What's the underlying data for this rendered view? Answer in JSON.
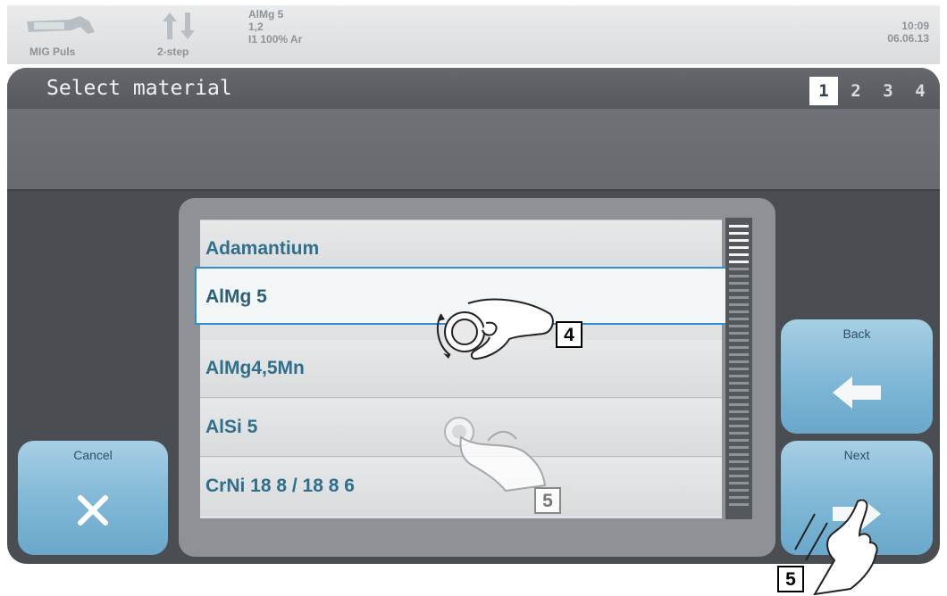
{
  "status": {
    "mode_label": "MIG Puls",
    "step_label": "2-step",
    "material_lines": [
      "AlMg 5",
      "1,2",
      "I1 100% Ar"
    ],
    "time": "10:09",
    "date": "06.06.13",
    "icons": [
      "mig-puls-torch-icon",
      "two-step-arrows-icon"
    ]
  },
  "header": {
    "title": "Select material",
    "pages": [
      "1",
      "2",
      "3",
      "4"
    ],
    "active_page": "1"
  },
  "materials": {
    "items": [
      "Adamantium",
      "AlMg 5",
      "AlMg4,5Mn",
      "AlSi 5",
      "CrNi 18 8 / 18 8 6"
    ],
    "selected": "AlMg 5"
  },
  "buttons": {
    "cancel": "Cancel",
    "back": "Back",
    "next": "Next",
    "icons": [
      "close-x-icon",
      "arrow-left-icon",
      "arrow-right-icon"
    ]
  },
  "callouts": {
    "dial": "4",
    "touch_list": "5",
    "touch_next": "5"
  },
  "colors": {
    "accent_blue": "#2d8fd0",
    "list_text": "#2f6f8c",
    "button_blue": "#7fb7d6"
  }
}
